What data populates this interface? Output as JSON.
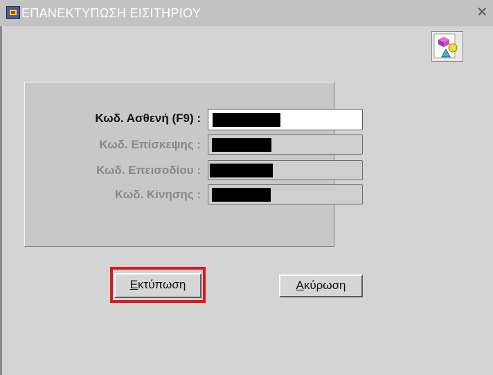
{
  "window": {
    "title": "ΕΠΑΝΕΚΤΥΠΩΣΗ ΕΙΣΙΤΗΡΙΟΥ",
    "close_glyph": "✕"
  },
  "form": {
    "fields": [
      {
        "label": "Κωδ. Ασθενή (F9) :",
        "active": true
      },
      {
        "label": "Κωδ. Επίσκεψης :",
        "active": false
      },
      {
        "label": "Κωδ. Επεισοδίου :",
        "active": false
      },
      {
        "label": "Κωδ. Κίνησης :",
        "active": false
      }
    ]
  },
  "buttons": {
    "print": {
      "mnemonic": "Ε",
      "rest": "κτύπωση"
    },
    "cancel": {
      "mnemonic": "Α",
      "rest": "κύρωση"
    }
  },
  "colors": {
    "background": "#d4d4d4",
    "titlebar": "#c2c2c2",
    "focus_highlight": "#e0171b",
    "redaction": "#000000"
  },
  "icons": {
    "app": "app-window-icon",
    "toolbar": "shapes-tool-icon",
    "close": "close-icon"
  }
}
